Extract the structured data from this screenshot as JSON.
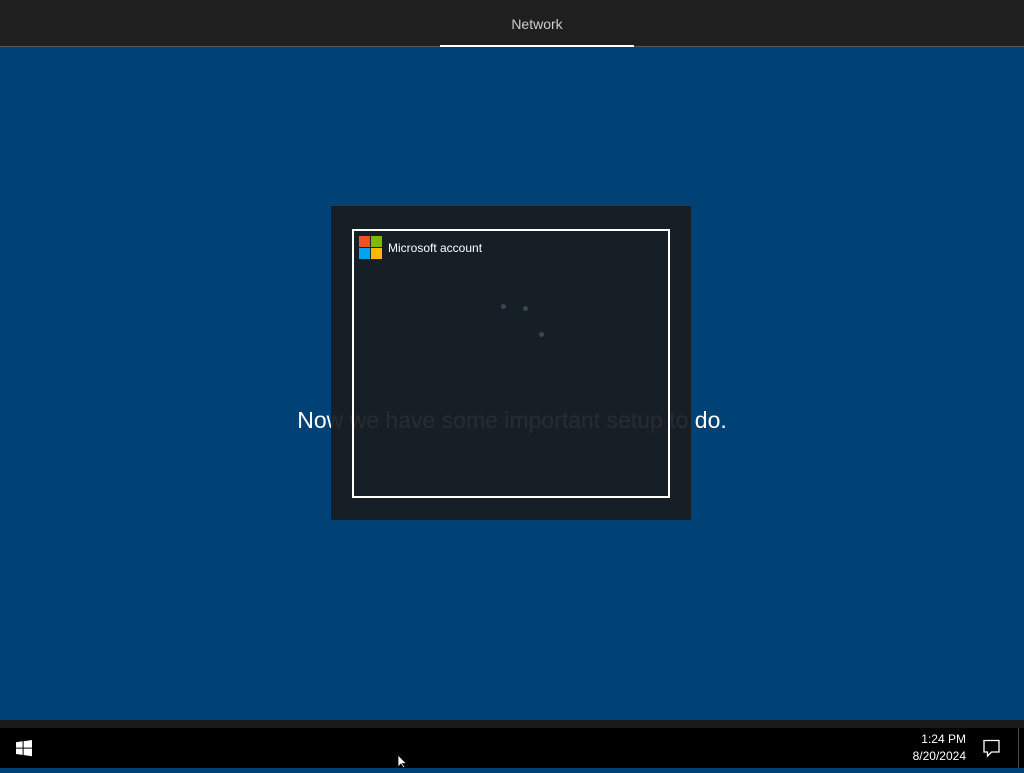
{
  "header": {
    "active_tab": "Network"
  },
  "main": {
    "message": "Now we have some important setup to do."
  },
  "dialog": {
    "title": "Microsoft account",
    "logo_colors": [
      "#f25022",
      "#7fba00",
      "#00a4ef",
      "#ffb900"
    ],
    "state": "loading"
  },
  "taskbar": {
    "start_icon": "windows-logo-icon",
    "time": "1:24 PM",
    "date": "8/20/2024",
    "notification_icon": "action-center-icon"
  },
  "colors": {
    "background": "#004275",
    "topbar": "#1f1f1f",
    "taskbar": "#000000"
  }
}
